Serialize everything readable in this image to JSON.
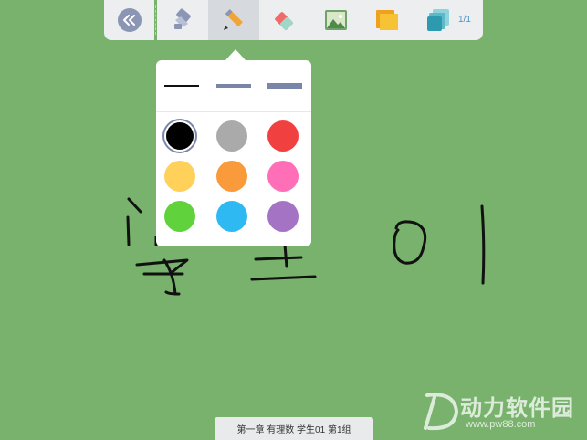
{
  "toolbar": {
    "tools": [
      {
        "id": "collapse",
        "icon": "double-chevron-left-icon"
      },
      {
        "id": "select",
        "icon": "hand-pointer-icon"
      },
      {
        "id": "pen",
        "icon": "pencil-icon",
        "active": true
      },
      {
        "id": "eraser",
        "icon": "eraser-icon"
      },
      {
        "id": "image",
        "icon": "image-icon"
      },
      {
        "id": "background",
        "icon": "folder-icon"
      },
      {
        "id": "pages",
        "icon": "layers-icon"
      }
    ],
    "page_counter": "1/1"
  },
  "pen_popover": {
    "stroke_widths": [
      "thin",
      "medium",
      "thick"
    ],
    "colors": [
      "#000000",
      "#aaaaaa",
      "#f0403f",
      "#ffd15a",
      "#f99a3b",
      "#ff6fb8",
      "#5fd23c",
      "#2eb9f3",
      "#a473c4"
    ],
    "selected_color": "#000000"
  },
  "status_bar": {
    "text": "第一章 有理数  学生01  第1组"
  },
  "watermark": {
    "title": "动力软件园",
    "url": "www.pw88.com"
  },
  "colors": {
    "canvas_background": "#78b26c",
    "toolbar_background": "#eceef0",
    "accent": "#4a90c8"
  }
}
